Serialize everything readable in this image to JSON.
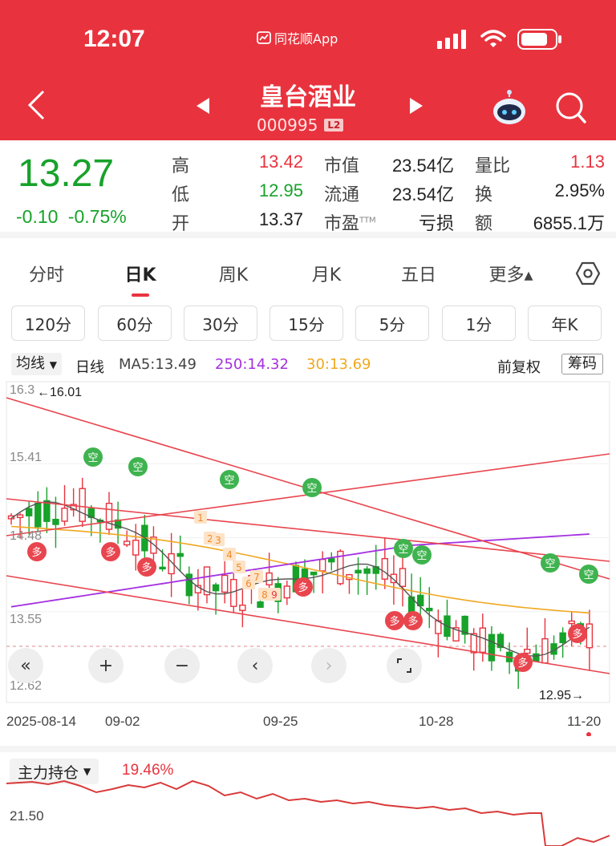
{
  "status_bar": {
    "time": "12:07",
    "app_name": "同花顺App"
  },
  "stock": {
    "name": "皇台酒业",
    "code": "000995",
    "level_badge": "L2"
  },
  "quote": {
    "price": "13.27",
    "change": "-0.10",
    "change_pct": "-0.75%",
    "high_label": "高",
    "high": "13.42",
    "low_label": "低",
    "low": "12.95",
    "open_label": "开",
    "open": "13.37",
    "mktcap_label": "市值",
    "mktcap": "23.54亿",
    "float_label": "流通",
    "float": "23.54亿",
    "pe_label": "市盈",
    "pe_sup": "TTM",
    "pe": "亏损",
    "vol_ratio_label": "量比",
    "vol_ratio": "1.13",
    "turnover_label": "换",
    "turnover": "2.95%",
    "amount_label": "额",
    "amount": "6855.1万"
  },
  "tabs": [
    "分时",
    "日K",
    "周K",
    "月K",
    "五日",
    "更多▴"
  ],
  "active_tab": "日K",
  "periods": [
    "120分",
    "60分",
    "30分",
    "15分",
    "5分",
    "1分",
    "年K"
  ],
  "indicator_row": {
    "selector": "均线",
    "line_type": "日线",
    "ma5": "MA5:13.49",
    "ma250": "250:14.32",
    "ma30": "30:13.69",
    "adjust": "前复权",
    "chips": "筹码"
  },
  "colors": {
    "up": "#e8333e",
    "down": "#17a22a",
    "ma5": "#555555",
    "ma250": "#a530e0",
    "ma30": "#f0a820",
    "accent": "#e8333e"
  },
  "chart_data": {
    "type": "candlestick",
    "y_axis_labels": [
      "16.3",
      "15.41",
      "14.48",
      "13.55",
      "12.62"
    ],
    "x_axis_labels": [
      "2025-08-14",
      "09-02",
      "09-25",
      "10-28",
      "11-20"
    ],
    "max_marker": "←16.01",
    "min_marker": "12.95→",
    "signals": {
      "bull": "多",
      "bear": "空"
    },
    "sequence_numbers": [
      "1",
      "2",
      "3",
      "4",
      "5",
      "6",
      "7",
      "8",
      "9"
    ],
    "ylim": [
      12.62,
      16.3
    ]
  },
  "bottom_indicator": {
    "name": "主力持仓",
    "value": "19.46%",
    "axis_label": "21.50"
  }
}
